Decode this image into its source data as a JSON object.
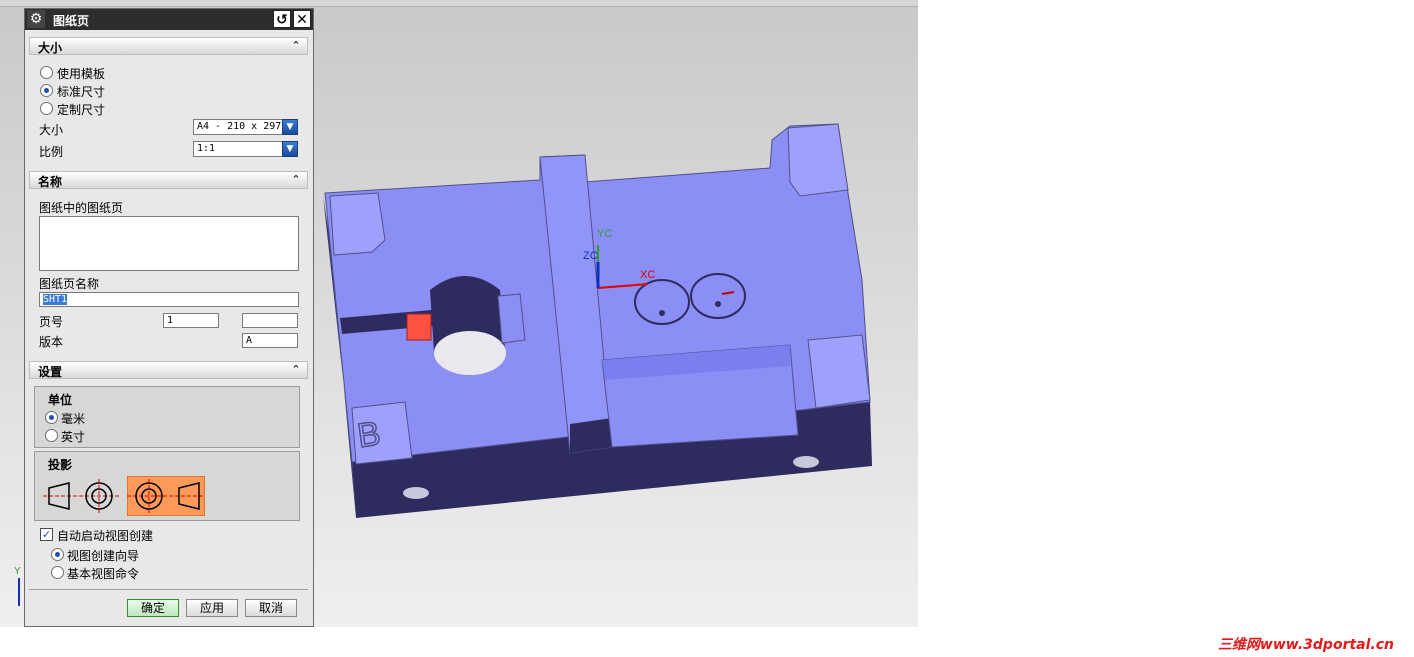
{
  "dialog": {
    "title": "图纸页",
    "section_size": {
      "header": "大小",
      "options": [
        "使用模板",
        "标准尺寸",
        "定制尺寸"
      ],
      "selected": 1,
      "size_label": "大小",
      "size_value": "A4 - 210 x 297",
      "scale_label": "比例",
      "scale_value": "1:1"
    },
    "section_name": {
      "header": "名称",
      "list_label": "图纸中的图纸页",
      "sheet_name_label": "图纸页名称",
      "sheet_name_value": "SHT1",
      "page_label": "页号",
      "page_value": "1",
      "page_value2": "",
      "revision_label": "版本",
      "revision_value": "A"
    },
    "section_settings": {
      "header": "设置",
      "units_title": "单位",
      "units": [
        "毫米",
        "英寸"
      ],
      "units_selected": 0,
      "projection_title": "投影",
      "auto_view_label": "自动启动视图创建",
      "auto_view_checked": true,
      "view_options": [
        "视图创建向导",
        "基本视图命令"
      ],
      "view_selected": 0
    },
    "buttons": {
      "ok": "确定",
      "apply": "应用",
      "cancel": "取消"
    }
  },
  "axes": {
    "yc": "YC",
    "xc": "XC",
    "zc": "ZC",
    "y_small": "Y"
  },
  "model": {
    "engraved_letter": "B"
  },
  "watermark": "三维网www.3dportal.cn",
  "colors": {
    "part_face": "#8a8ef5",
    "part_side": "#2e2c5e",
    "annotation": "#e00000",
    "titlebar": "#2d2d2d"
  }
}
